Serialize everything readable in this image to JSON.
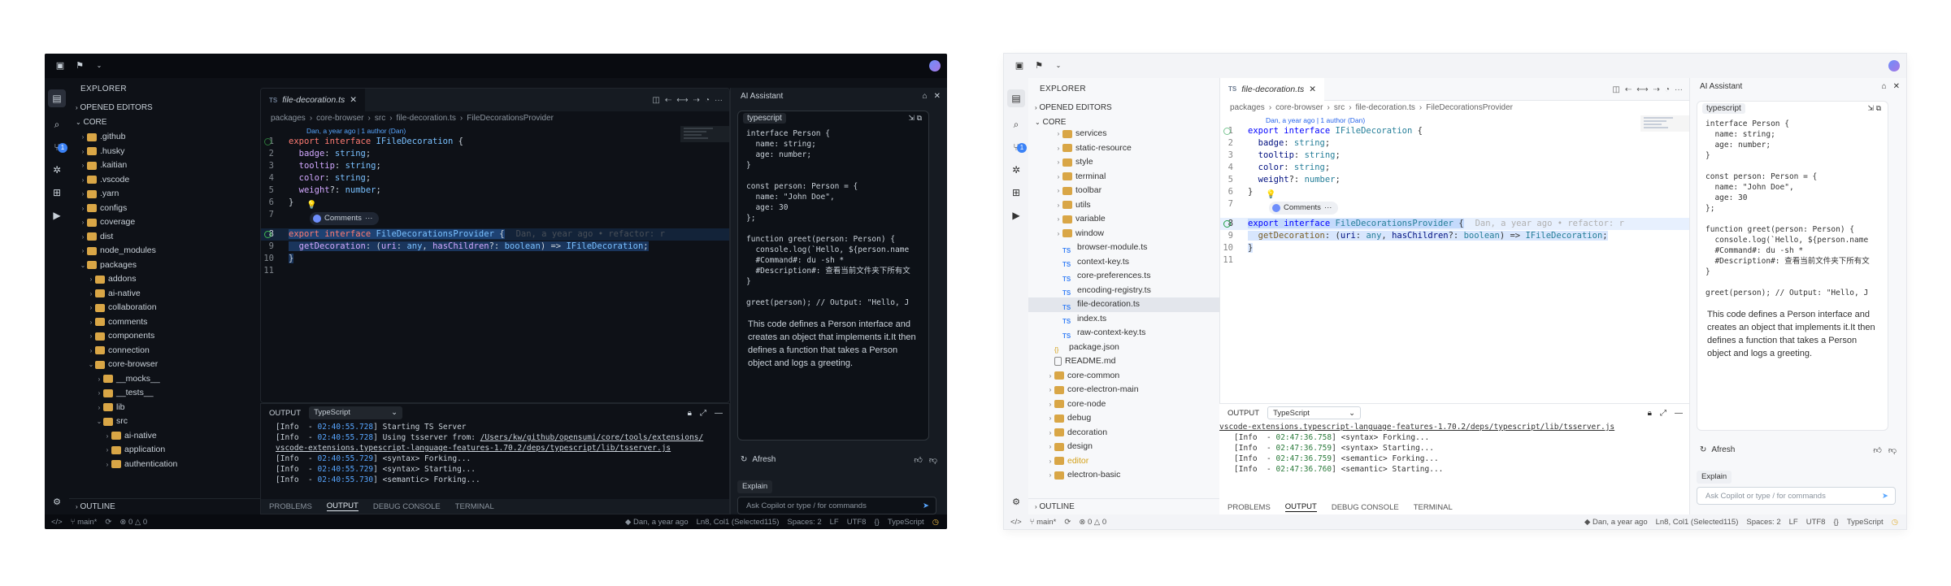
{
  "shared": {
    "assistant_title": "AI Assistant",
    "explorer_title": "EXPLORER",
    "opened_editors": "OPENED EDITORS",
    "core_label": "CORE",
    "outline_label": "OUTLINE",
    "tab_lang": "TS",
    "tab_title": "file-decoration.ts",
    "breadcrumbs": [
      "packages",
      "core-browser",
      "src",
      "file-decoration.ts",
      "FileDecorationsProvider"
    ],
    "blame_top": "Dan, a year ago | 1 author (Dan)",
    "line_numbers": [
      "1",
      "2",
      "3",
      "4",
      "5",
      "6",
      "7",
      "8",
      "9",
      "10",
      "11"
    ],
    "comments_label": "Comments",
    "comments_more": "···",
    "ghost_blame": "Dan, a year ago • refactor: r",
    "output_label": "OUTPUT",
    "output_select": "TypeScript",
    "panel_tabs": [
      "PROBLEMS",
      "OUTPUT",
      "DEBUG CONSOLE",
      "TERMINAL"
    ],
    "ai_lang_tag": "typescript",
    "ai_code": "interface Person {\n  name: string;\n  age: number;\n}\n\nconst person: Person = {\n  name: \"John Doe\",\n  age: 30\n};\n\nfunction greet(person: Person) {\n  console.log(`Hello, ${person.name\n  #Command#: du -sh *\n  #Description#: 查看当前文件夹下所有文\n}\n\ngreet(person); // Output: \"Hello, J",
    "ai_text": "This code defines a Person interface and creates an object that implements it.It then defines a function that takes a Person object and logs a greeting.",
    "afresh": "Afresh",
    "explain": "Explain",
    "ai_input_placeholder": "Ask Copilot or type / for commands",
    "status": {
      "branch": "main*",
      "errors": "0",
      "warnings": "0",
      "blame": "Dan, a year ago",
      "position": "Ln8, Col1 (Selected115)",
      "spaces": "Spaces: 2",
      "eol": "LF",
      "encoding": "UTF8",
      "language": "TypeScript"
    }
  },
  "dark": {
    "tree": [
      {
        "label": ".github",
        "indent": 1,
        "kind": "gh"
      },
      {
        "label": ".husky",
        "indent": 1,
        "kind": "folder"
      },
      {
        "label": ".kaitian",
        "indent": 1,
        "kind": "folder"
      },
      {
        "label": ".vscode",
        "indent": 1,
        "kind": "folder"
      },
      {
        "label": ".yarn",
        "indent": 1,
        "kind": "folder"
      },
      {
        "label": "configs",
        "indent": 1,
        "kind": "folder"
      },
      {
        "label": "coverage",
        "indent": 1,
        "kind": "folder"
      },
      {
        "label": "dist",
        "indent": 1,
        "kind": "folder"
      },
      {
        "label": "node_modules",
        "indent": 1,
        "kind": "folder"
      },
      {
        "label": "packages",
        "indent": 1,
        "kind": "folder",
        "open": true
      },
      {
        "label": "addons",
        "indent": 2,
        "kind": "folder"
      },
      {
        "label": "ai-native",
        "indent": 2,
        "kind": "folder"
      },
      {
        "label": "collaboration",
        "indent": 2,
        "kind": "folder"
      },
      {
        "label": "comments",
        "indent": 2,
        "kind": "folder"
      },
      {
        "label": "components",
        "indent": 2,
        "kind": "folder"
      },
      {
        "label": "connection",
        "indent": 2,
        "kind": "folder"
      },
      {
        "label": "core-browser",
        "indent": 2,
        "kind": "folder",
        "open": true
      },
      {
        "label": "__mocks__",
        "indent": 3,
        "kind": "folder"
      },
      {
        "label": "__tests__",
        "indent": 3,
        "kind": "folder"
      },
      {
        "label": "lib",
        "indent": 3,
        "kind": "folder"
      },
      {
        "label": "src",
        "indent": 3,
        "kind": "folder",
        "open": true
      },
      {
        "label": "ai-native",
        "indent": 4,
        "kind": "folder"
      },
      {
        "label": "application",
        "indent": 4,
        "kind": "folder"
      },
      {
        "label": "authentication",
        "indent": 4,
        "kind": "folder"
      }
    ],
    "log": [
      {
        "ts": "02:40:55.728",
        "msg": "Starting TS Server"
      },
      {
        "ts": "02:40:55.728",
        "msg": "Using tsserver from: ",
        "link": "/Users/kw/github/opensumi/core/tools/extensions/"
      },
      {
        "ts": "",
        "msg": "",
        "link": "vscode-extensions.typescript-language-features-1.70.2/deps/typescript/lib/tsserver.js"
      },
      {
        "ts": "02:40:55.729",
        "msg": "<syntax> Forking..."
      },
      {
        "ts": "02:40:55.729",
        "msg": "<syntax> Starting..."
      },
      {
        "ts": "02:40:55.730",
        "msg": "<semantic> Forking..."
      }
    ]
  },
  "light": {
    "tree": [
      {
        "label": "services",
        "indent": 3,
        "kind": "folder"
      },
      {
        "label": "static-resource",
        "indent": 3,
        "kind": "folder"
      },
      {
        "label": "style",
        "indent": 3,
        "kind": "folder"
      },
      {
        "label": "terminal",
        "indent": 3,
        "kind": "folder"
      },
      {
        "label": "toolbar",
        "indent": 3,
        "kind": "folder"
      },
      {
        "label": "utils",
        "indent": 3,
        "kind": "folder"
      },
      {
        "label": "variable",
        "indent": 3,
        "kind": "folder"
      },
      {
        "label": "window",
        "indent": 3,
        "kind": "folder"
      },
      {
        "label": "browser-module.ts",
        "indent": 3,
        "kind": "ts"
      },
      {
        "label": "context-key.ts",
        "indent": 3,
        "kind": "ts"
      },
      {
        "label": "core-preferences.ts",
        "indent": 3,
        "kind": "ts"
      },
      {
        "label": "encoding-registry.ts",
        "indent": 3,
        "kind": "ts"
      },
      {
        "label": "file-decoration.ts",
        "indent": 3,
        "kind": "ts",
        "selected": true
      },
      {
        "label": "index.ts",
        "indent": 3,
        "kind": "ts"
      },
      {
        "label": "raw-context-key.ts",
        "indent": 3,
        "kind": "ts"
      },
      {
        "label": "package.json",
        "indent": 2,
        "kind": "json"
      },
      {
        "label": "README.md",
        "indent": 2,
        "kind": "md"
      },
      {
        "label": "core-common",
        "indent": 2,
        "kind": "folder"
      },
      {
        "label": "core-electron-main",
        "indent": 2,
        "kind": "folder"
      },
      {
        "label": "core-node",
        "indent": 2,
        "kind": "folder"
      },
      {
        "label": "debug",
        "indent": 2,
        "kind": "folder"
      },
      {
        "label": "decoration",
        "indent": 2,
        "kind": "folder"
      },
      {
        "label": "design",
        "indent": 2,
        "kind": "folder"
      },
      {
        "label": "editor",
        "indent": 2,
        "kind": "folder"
      },
      {
        "label": "electron-basic",
        "indent": 2,
        "kind": "folder"
      }
    ],
    "log": [
      {
        "ts": "",
        "msg": "",
        "link": "vscode-extensions.typescript-language-features-1.70.2/deps/typescript/lib/tsserver.js"
      },
      {
        "ts": "02:47:36.758",
        "msg": "<syntax> Forking..."
      },
      {
        "ts": "02:47:36.759",
        "msg": "<syntax> Starting..."
      },
      {
        "ts": "02:47:36.759",
        "msg": "<semantic> Forking..."
      },
      {
        "ts": "02:47:36.760",
        "msg": "<semantic> Starting..."
      }
    ]
  },
  "colors": {
    "accent": "#3b82f6",
    "folder": "#d9a646",
    "warn": "#e3b341"
  },
  "icons": [
    "sidebar-toggle-icon",
    "branch-icon",
    "files-icon",
    "search-icon",
    "scm-icon",
    "debug-icon",
    "extensions-icon",
    "run-icon",
    "gear-icon",
    "code-icon",
    "bell-icon"
  ]
}
